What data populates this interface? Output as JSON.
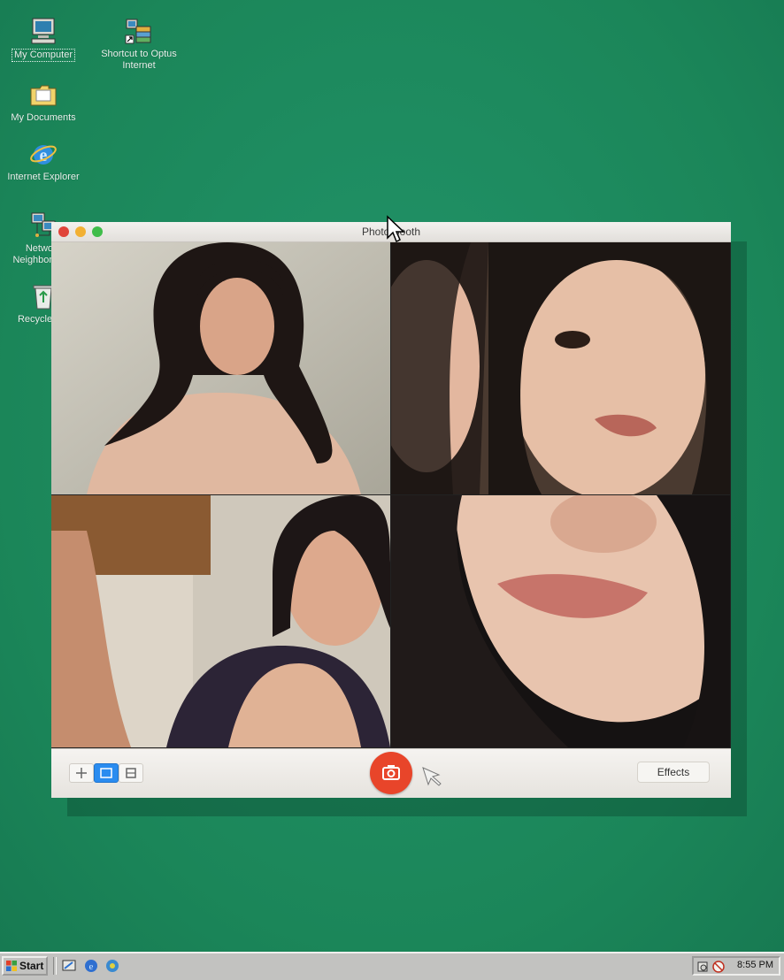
{
  "desktop": {
    "icons": [
      {
        "label": "My Computer",
        "icon": "computer-icon"
      },
      {
        "label": "Shortcut to Optus Internet",
        "icon": "network-shortcut-icon"
      },
      {
        "label": "My Documents",
        "icon": "folder-icon"
      },
      {
        "label": "Internet Explorer",
        "icon": "internet-explorer-icon"
      },
      {
        "label": "Network Neighborhood",
        "icon": "network-neighborhood-icon"
      },
      {
        "label": "Recycle Bin",
        "icon": "recycle-bin-icon"
      }
    ]
  },
  "window": {
    "title": "Photo Booth",
    "photos": [
      "photo-1",
      "photo-2",
      "photo-3",
      "photo-4"
    ],
    "toolbar": {
      "view_buttons": [
        "grid-view-icon",
        "single-view-icon",
        "filmstrip-view-icon"
      ],
      "active_view": "single-view-icon",
      "shutter_icon": "camera-icon",
      "effects_label": "Effects"
    }
  },
  "taskbar": {
    "start_label": "Start",
    "quick_launch": [
      "desktop-icon",
      "internet-explorer-icon",
      "channels-icon"
    ],
    "tray_icons": [
      "speaker-icon",
      "network-tray-icon"
    ],
    "clock": "8:55 PM"
  },
  "colors": {
    "desktop": "#1d8a5e",
    "shutter": "#e8452a",
    "active_view": "#2a8cf0"
  }
}
